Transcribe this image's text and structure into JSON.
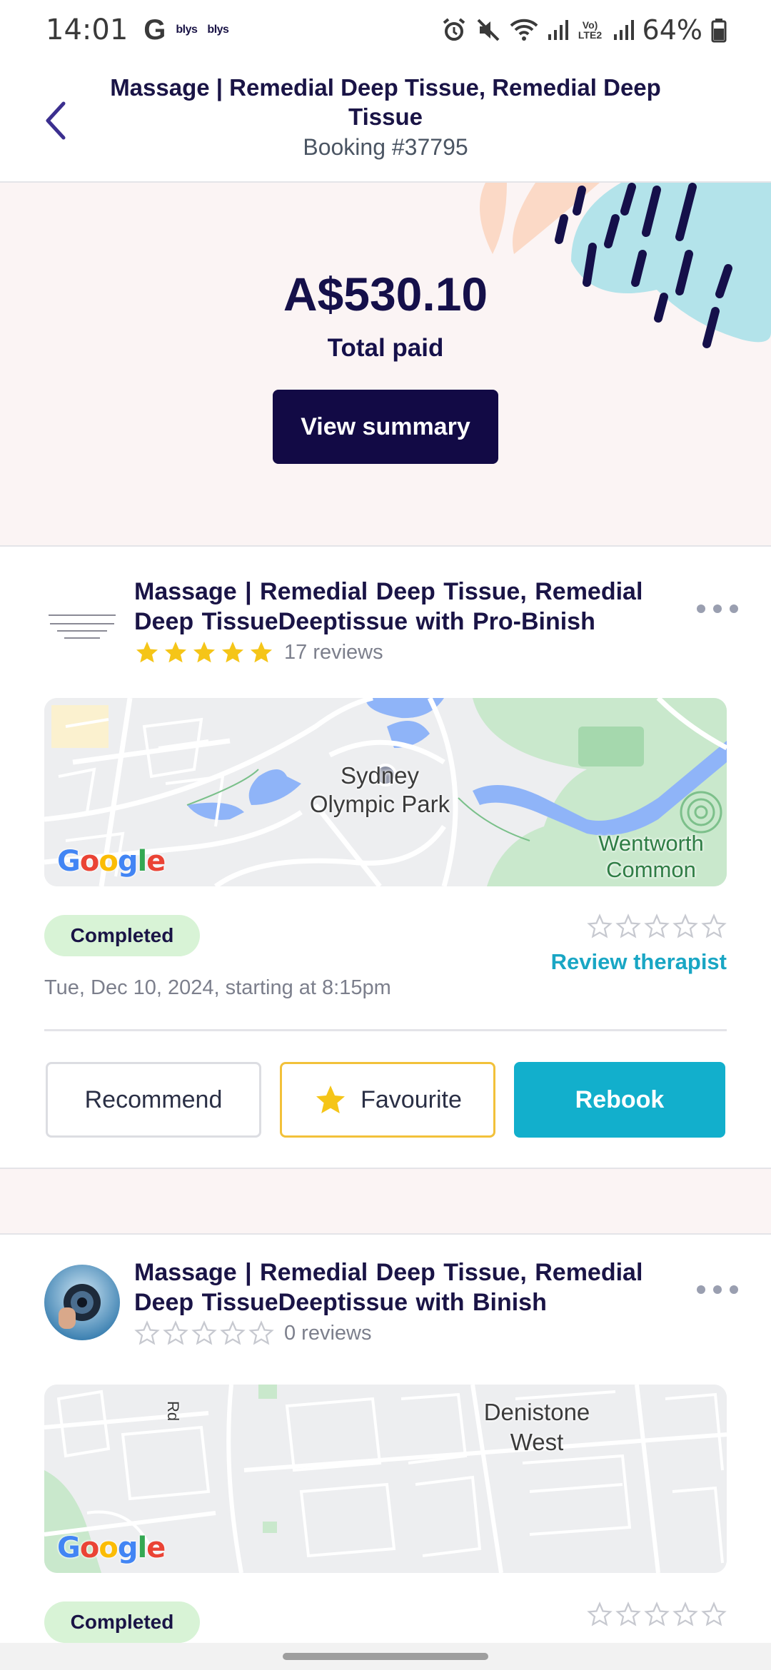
{
  "status_bar": {
    "time": "14:01",
    "g_letter": "G",
    "app_icon_1": "blys",
    "app_icon_2": "blys",
    "battery": "64%",
    "volte": "Vo) LTE2",
    "icons": [
      "alarm-icon",
      "mute-icon",
      "wifi-icon",
      "signal-icon",
      "battery-icon"
    ]
  },
  "header": {
    "title": "Massage | Remedial Deep Tissue, Remedial Deep Tissue",
    "booking": "Booking #37795"
  },
  "summary": {
    "amount": "A$530.10",
    "label": "Total paid",
    "button": "View summary"
  },
  "bookings": [
    {
      "title": "Massage  |  Remedial Deep Tissue, Remedial Deep TissueDeeptissue with Pro-Binish",
      "rating_filled": 5,
      "reviews": "17 reviews",
      "map_labels": [
        "Sydney",
        "Olympic Park",
        "Wentworth",
        "Common"
      ],
      "map_logo": "Google",
      "status": "Completed",
      "date": "Tue, Dec 10, 2024, starting at 8:15pm",
      "review_link": "Review therapist",
      "actions": {
        "recommend": "Recommend",
        "favourite": "Favourite",
        "rebook": "Rebook"
      }
    },
    {
      "title": "Massage  |  Remedial Deep Tissue, Remedial Deep TissueDeeptissue with Binish",
      "rating_filled": 0,
      "reviews": "0 reviews",
      "map_labels": [
        "Denistone",
        "West",
        "Rd"
      ],
      "map_logo": "Google",
      "status": "Completed"
    }
  ],
  "colors": {
    "primary_dark": "#120a45",
    "accent_teal": "#12afcc",
    "star_yellow": "#f5c518",
    "badge_green": "#d8f3d6",
    "hero_bg": "#fbf4f4"
  }
}
